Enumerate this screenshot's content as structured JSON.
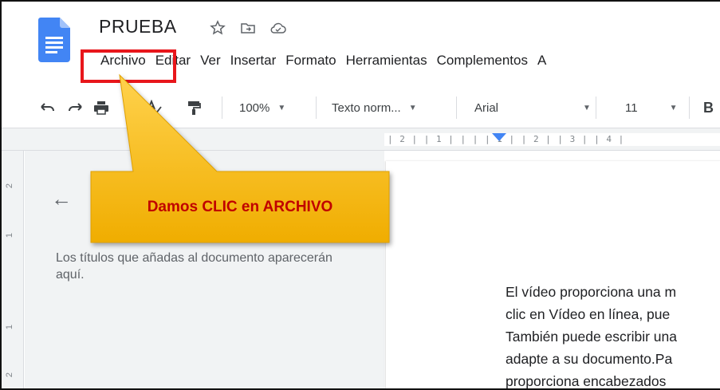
{
  "document": {
    "title": "PRUEBA"
  },
  "title_icons": [
    "star-icon",
    "move-to-folder-icon",
    "cloud-status-icon"
  ],
  "menu": {
    "items": [
      "Archivo",
      "Editar",
      "Ver",
      "Insertar",
      "Formato",
      "Herramientas",
      "Complementos",
      "A"
    ]
  },
  "toolbar": {
    "zoom": "100%",
    "style": "Texto norm...",
    "font": "Arial",
    "font_size": "11",
    "bold": "B"
  },
  "ruler": {
    "horizontal": "| 2 |  | 1 |  |    |  | 1 |  | 2 |  | 3 |  | 4 |",
    "vertical_labels": [
      "2",
      "1",
      "1",
      "2"
    ]
  },
  "outline": {
    "empty_text": "Los títulos que añadas al documento aparecerán aquí."
  },
  "page": {
    "lines": [
      "El vídeo proporciona una m",
      "clic en Vídeo en línea, pue",
      "También puede escribir una",
      "adapte a su documento.Pa",
      "proporciona encabezados"
    ]
  },
  "annotation": {
    "callout_text": "Damos CLIC en ARCHIVO",
    "box_color": "#e8161b",
    "callout_color": "#f5b800",
    "text_color": "#c00000"
  }
}
